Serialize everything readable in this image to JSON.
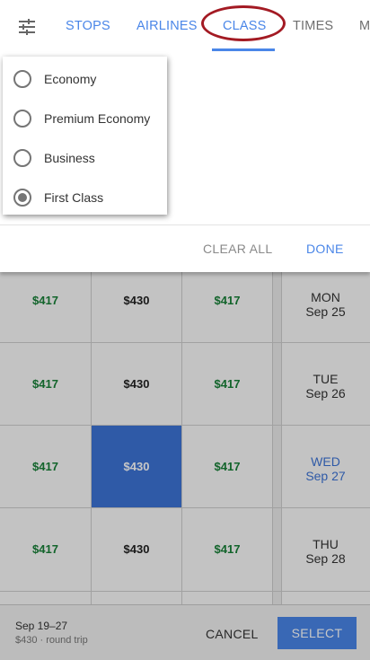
{
  "tabs": {
    "stops": "STOPS",
    "airlines": "AIRLINES",
    "class": "CLASS",
    "times": "TIMES",
    "more": "M"
  },
  "class_dropdown": {
    "options": [
      {
        "label": "Economy",
        "checked": false
      },
      {
        "label": "Premium Economy",
        "checked": false
      },
      {
        "label": "Business",
        "checked": false
      },
      {
        "label": "First Class",
        "checked": true
      }
    ]
  },
  "actions": {
    "clear_all": "CLEAR ALL",
    "done": "DONE"
  },
  "price_grid": {
    "rows": [
      {
        "prices": [
          "$417",
          "$430",
          "$417"
        ],
        "day": "MON",
        "date": "Sep 25"
      },
      {
        "prices": [
          "$417",
          "$430",
          "$417"
        ],
        "day": "TUE",
        "date": "Sep 26"
      },
      {
        "prices": [
          "$417",
          "$430",
          "$417"
        ],
        "day": "WED",
        "date": "Sep 27"
      },
      {
        "prices": [
          "$417",
          "$430",
          "$417"
        ],
        "day": "THU",
        "date": "Sep 28"
      }
    ],
    "selected_price": "$430",
    "colors": {
      "low_price": "#188038",
      "selected_cell": "#3d74d6"
    }
  },
  "footer": {
    "dates": "Sep 19–27",
    "summary": "$430 · round trip",
    "cancel": "CANCEL",
    "select": "SELECT"
  },
  "icons": {
    "filter": "filter-sliders-icon"
  },
  "colors": {
    "accent": "#4a86e8",
    "annotation": "#a31a23"
  }
}
